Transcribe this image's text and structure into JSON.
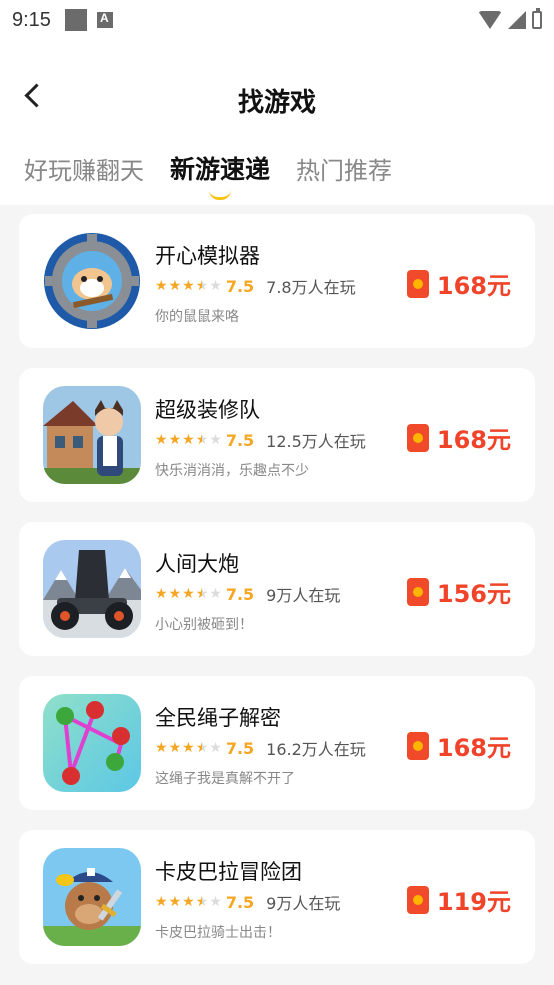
{
  "status": {
    "time": "9:15"
  },
  "header": {
    "title": "找游戏",
    "tabs": [
      {
        "label": "好玩赚翻天",
        "active": false
      },
      {
        "label": "新游速递",
        "active": true
      },
      {
        "label": "热门推荐",
        "active": false
      }
    ]
  },
  "games": [
    {
      "name": "开心模拟器",
      "score": "7.5",
      "players": "7.8万人在玩",
      "desc": "你的鼠鼠来咯",
      "reward": "168元",
      "icon": "hamster-gear-icon"
    },
    {
      "name": "超级装修队",
      "score": "7.5",
      "players": "12.5万人在玩",
      "desc": "快乐消消消，乐趣点不少",
      "reward": "168元",
      "icon": "cat-girl-house-icon"
    },
    {
      "name": "人间大炮",
      "score": "7.5",
      "players": "9万人在玩",
      "desc": "小心别被砸到！",
      "reward": "156元",
      "icon": "cannon-icon"
    },
    {
      "name": "全民绳子解密",
      "score": "7.5",
      "players": "16.2万人在玩",
      "desc": "这绳子我是真解不开了",
      "reward": "168元",
      "icon": "rope-puzzle-icon"
    },
    {
      "name": "卡皮巴拉冒险团",
      "score": "7.5",
      "players": "9万人在玩",
      "desc": "卡皮巴拉骑士出击！",
      "reward": "119元",
      "icon": "capybara-knight-icon"
    }
  ],
  "colors": {
    "accent": "#f5c518",
    "reward": "#f0442a",
    "star": "#f5a623"
  }
}
